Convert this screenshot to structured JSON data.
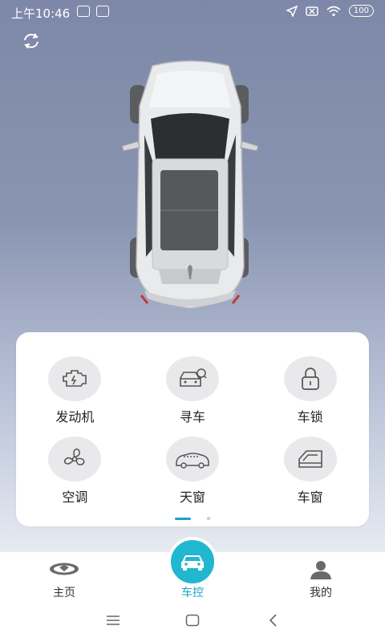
{
  "status_bar": {
    "time": "上午10:46",
    "battery": "100",
    "icons": [
      "gallery-icon",
      "cloud-icon",
      "location-arrow-icon",
      "no-sim-icon",
      "wifi-icon",
      "battery-icon"
    ]
  },
  "controls": [
    {
      "label": "发动机",
      "icon": "engine-icon"
    },
    {
      "label": "寻车",
      "icon": "find-car-icon"
    },
    {
      "label": "车锁",
      "icon": "lock-icon"
    },
    {
      "label": "空调",
      "icon": "fan-icon"
    },
    {
      "label": "天窗",
      "icon": "sunroof-icon"
    },
    {
      "label": "车窗",
      "icon": "window-icon"
    }
  ],
  "tabs": [
    {
      "label": "主页",
      "icon": "home-logo-icon"
    },
    {
      "label": "车控",
      "icon": "car-icon",
      "active": true
    },
    {
      "label": "我的",
      "icon": "profile-icon"
    }
  ],
  "colors": {
    "accent": "#21b7cf",
    "active_text": "#19a3c2",
    "hero_top": "#7d88a8"
  }
}
